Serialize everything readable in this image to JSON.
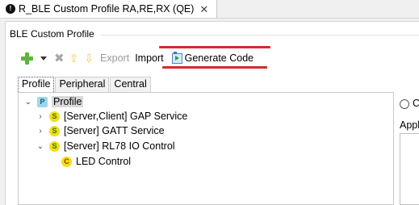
{
  "tab": {
    "title": "R_BLE Custom Profile RA,RE,RX (QE)",
    "close": "✕",
    "icon_letter": "!"
  },
  "section": {
    "title": "BLE Custom Profile"
  },
  "toolbar": {
    "export_label": "Export",
    "import_label": "Import",
    "generate_label": "Generate Code",
    "highlight_color": "#d42a2a"
  },
  "subtabs": [
    {
      "label": "Profile",
      "active": true
    },
    {
      "label": "Peripheral",
      "active": false
    },
    {
      "label": "Central",
      "active": false
    }
  ],
  "tree": [
    {
      "label": "Profile",
      "badge": "P",
      "expanded": true,
      "selected": true
    },
    {
      "label": "[Server,Client] GAP Service",
      "badge": "S",
      "expanded": false
    },
    {
      "label": "[Server] GATT Service",
      "badge": "S",
      "expanded": false
    },
    {
      "label": "[Server] RL78 IO Control",
      "badge": "S",
      "expanded": true
    },
    {
      "label": "LED Control",
      "badge": "C"
    }
  ],
  "right_panel": {
    "radio_label": "C",
    "label": "Appl"
  }
}
